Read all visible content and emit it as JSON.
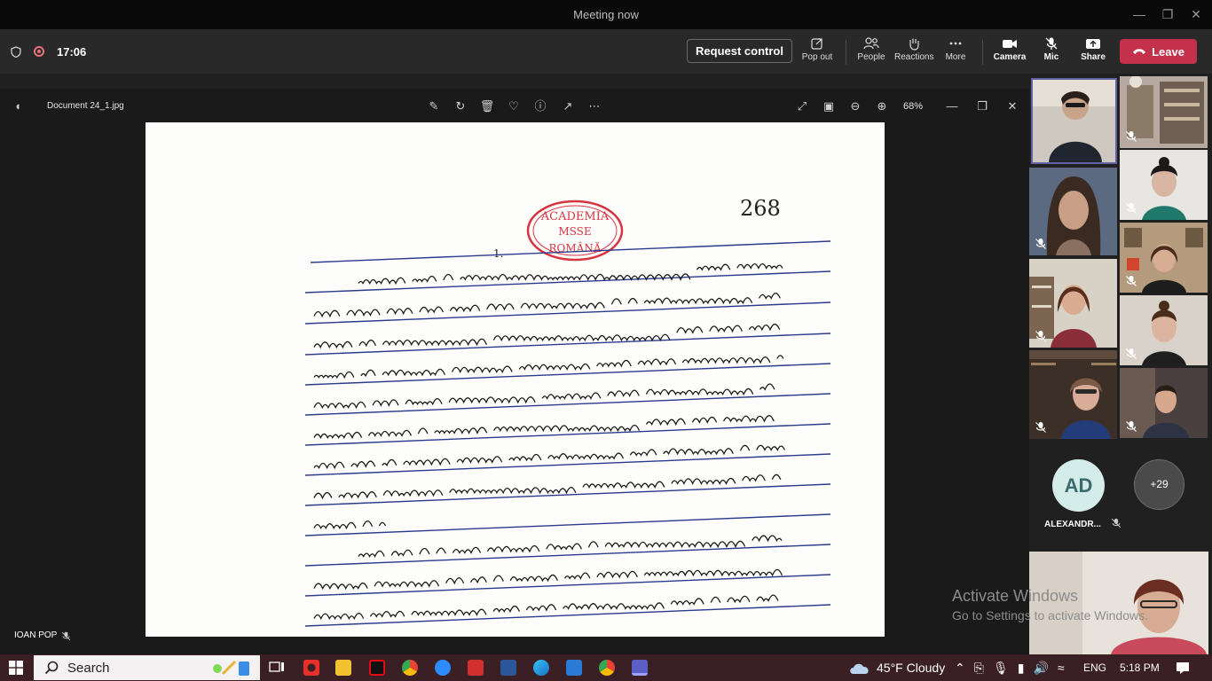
{
  "window": {
    "title": "Meeting now"
  },
  "meeting": {
    "timer": "17:06",
    "request_control_label": "Request control",
    "buttons": {
      "popout": "Pop out",
      "people": "People",
      "reactions": "Reactions",
      "more": "More",
      "camera": "Camera",
      "mic": "Mic",
      "share": "Share",
      "leave": "Leave"
    }
  },
  "viewer": {
    "filename": "Document 24_1.jpg",
    "zoom": "68%"
  },
  "document": {
    "stamp_lines": [
      "ACADEMIA",
      "MSSE",
      "ROMÂNĂ"
    ],
    "page_number": "268",
    "section_mark": "1."
  },
  "gallery": {
    "avatar_initials": "AD",
    "avatar_name": "ALEXANDR...",
    "overflow_count": "+29"
  },
  "presenter_badge": "IOAN POP",
  "watermark": {
    "line1": "Activate Windows",
    "line2": "Go to Settings to activate Windows."
  },
  "taskbar": {
    "search_label": "Search",
    "weather": "45°F  Cloudy",
    "language": "ENG",
    "clock": "5:18 PM"
  },
  "colors": {
    "leave": "#c4314b",
    "accent": "#6264a7",
    "stamp": "#d8343f"
  }
}
